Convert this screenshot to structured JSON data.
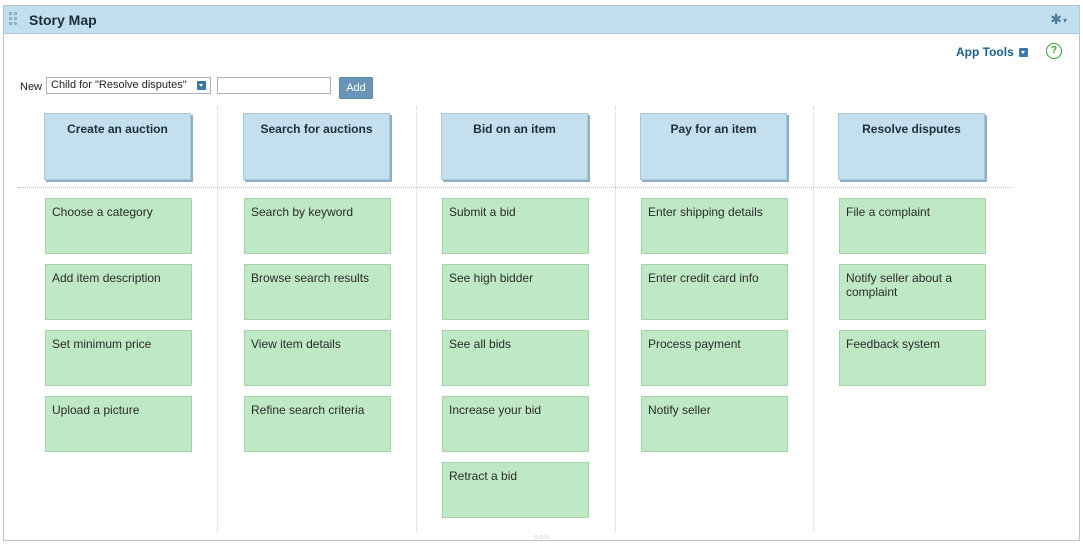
{
  "header": {
    "title": "Story Map",
    "gear_icon": "gear-icon"
  },
  "toolbar": {
    "app_tools_label": "App Tools",
    "help_icon": "?",
    "new_label": "New",
    "parent_select": "Child for \"Resolve disputes\"",
    "name_value": "",
    "add_label": "Add"
  },
  "activities": [
    {
      "label": "Create an auction",
      "stories": [
        "Choose a category",
        "Add item description",
        "Set minimum price",
        "Upload a picture"
      ]
    },
    {
      "label": "Search for auctions",
      "stories": [
        "Search by keyword",
        "Browse search results",
        "View item details",
        "Refine search criteria"
      ]
    },
    {
      "label": "Bid on an item",
      "stories": [
        "Submit a bid",
        "See high bidder",
        "See all bids",
        "Increase your bid",
        "Retract a bid"
      ]
    },
    {
      "label": "Pay for an item",
      "stories": [
        "Enter shipping details",
        "Enter credit card info",
        "Process payment",
        "Notify seller"
      ]
    },
    {
      "label": "Resolve disputes",
      "stories": [
        "File a complaint",
        "Notify seller about a complaint",
        "Feedback system"
      ]
    }
  ],
  "colors": {
    "activity_card": "#c4e0ef",
    "story_card": "#bfe9c4",
    "titlebar": "#c2dfef",
    "accent": "#3b78a8"
  }
}
